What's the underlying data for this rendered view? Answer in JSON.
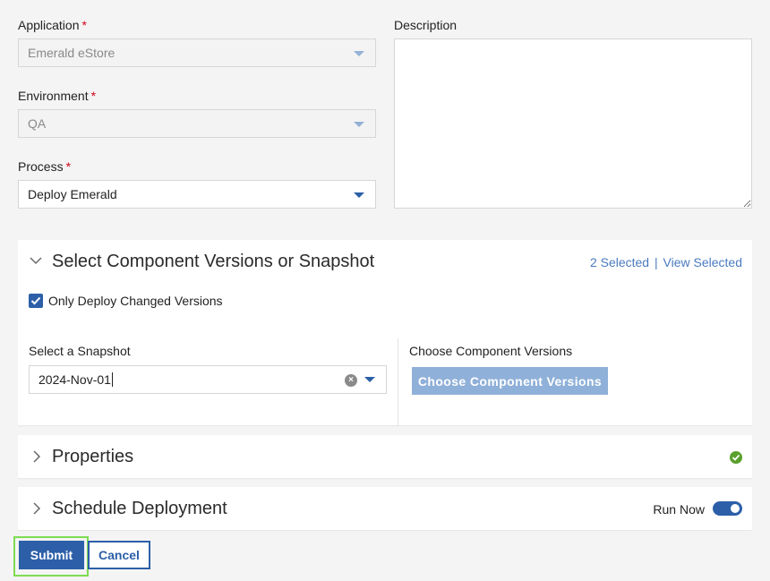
{
  "form": {
    "application": {
      "label": "Application",
      "required_mark": "*",
      "value": "Emerald eStore"
    },
    "environment": {
      "label": "Environment",
      "required_mark": "*",
      "value": "QA"
    },
    "process": {
      "label": "Process",
      "required_mark": "*",
      "value": "Deploy Emerald"
    },
    "description": {
      "label": "Description",
      "value": ""
    }
  },
  "component_panel": {
    "title": "Select Component Versions or Snapshot",
    "selected_count": "2 Selected",
    "separator": "|",
    "view_selected": "View Selected",
    "only_changed": {
      "label": "Only Deploy Changed Versions",
      "checked": true
    },
    "snapshot": {
      "label": "Select a Snapshot",
      "value": "2024-Nov-01"
    },
    "choose_versions": {
      "label": "Choose Component Versions",
      "button_label": "Choose Component Versions"
    }
  },
  "properties_panel": {
    "title": "Properties",
    "status": "complete"
  },
  "schedule_panel": {
    "title": "Schedule Deployment",
    "run_now_label": "Run Now",
    "run_now_on": true
  },
  "actions": {
    "submit_label": "Submit",
    "cancel_label": "Cancel"
  },
  "colors": {
    "accent": "#2c5fa8",
    "required": "#d0021b",
    "success": "#5aa02c",
    "focus": "#7ddc52",
    "disabled_button": "#8fb0d8"
  },
  "icons": [
    "chevron-down-icon",
    "chevron-right-icon",
    "check-icon",
    "clear-icon",
    "success-check-icon",
    "caret-down-icon"
  ]
}
